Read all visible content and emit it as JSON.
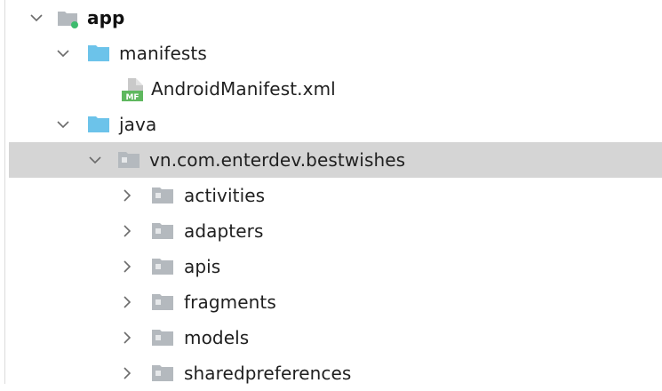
{
  "tree": {
    "items": [
      {
        "label": "app",
        "expanded": true,
        "icon": "module-folder-icon"
      },
      {
        "label": "manifests",
        "expanded": true,
        "icon": "folder-icon"
      },
      {
        "label": "AndroidManifest.xml",
        "icon": "manifest-file-icon",
        "icon_text": "MF"
      },
      {
        "label": "java",
        "expanded": true,
        "icon": "folder-icon"
      },
      {
        "label": "vn.com.enterdev.bestwishes",
        "expanded": true,
        "selected": true,
        "icon": "package-icon"
      },
      {
        "label": "activities",
        "expanded": false,
        "icon": "package-icon"
      },
      {
        "label": "adapters",
        "expanded": false,
        "icon": "package-icon"
      },
      {
        "label": "apis",
        "expanded": false,
        "icon": "package-icon"
      },
      {
        "label": "fragments",
        "expanded": false,
        "icon": "package-icon"
      },
      {
        "label": "models",
        "expanded": false,
        "icon": "package-icon"
      },
      {
        "label": "sharedpreferences",
        "expanded": false,
        "icon": "package-icon"
      }
    ]
  },
  "colors": {
    "selection": "#d5d5d5",
    "folder_blue": "#6cc3ea",
    "package_gray": "#b4b9be",
    "module_dot": "#3dbb6e",
    "manifest_green": "#5fb85f"
  }
}
